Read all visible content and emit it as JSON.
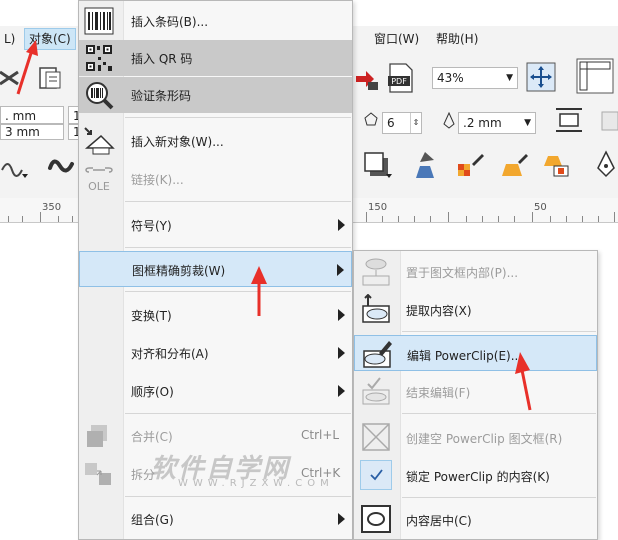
{
  "menubar": {
    "items": [
      {
        "label": "L)"
      },
      {
        "label": "对象(C)",
        "active": true
      },
      {
        "label": "窗口(W)"
      },
      {
        "label": "帮助(H)"
      }
    ]
  },
  "toolbar": {
    "zoom_value": "43%",
    "file_badge": "PDF"
  },
  "propbar": {
    "field1": ". mm",
    "field2": "3 mm",
    "field3": "1",
    "field4": "1",
    "sides_value": "6",
    "outline_value": ".2 mm"
  },
  "ruler": {
    "ticks": [
      "350",
      "150",
      "50"
    ]
  },
  "menu": {
    "items": [
      {
        "label": "插入条码(B)...",
        "icon": "barcode-icon"
      },
      {
        "label": "插入 QR 码",
        "icon": "qr-code-icon"
      },
      {
        "label": "验证条形码",
        "icon": "barcode-magnifier-icon"
      },
      {
        "label": "插入新对象(W)...",
        "icon": "insert-object-icon"
      },
      {
        "label": "链接(K)...",
        "icon": "ole-link-icon"
      },
      {
        "label": "符号(Y)"
      },
      {
        "label": "图框精确剪裁(W)"
      },
      {
        "label": "变换(T)"
      },
      {
        "label": "对齐和分布(A)"
      },
      {
        "label": "顺序(O)"
      },
      {
        "label": "合并(C)",
        "shortcut": "Ctrl+L",
        "icon": "combine-icon"
      },
      {
        "label": "拆分",
        "shortcut": "Ctrl+K",
        "icon": "break-apart-icon"
      },
      {
        "label": "组合(G)"
      }
    ]
  },
  "submenu": {
    "items": [
      {
        "label": "置于图文框内部(P)...",
        "icon": "place-inside-frame-icon"
      },
      {
        "label": "提取内容(X)",
        "icon": "extract-contents-icon"
      },
      {
        "label": "编辑 PowerClip(E)...",
        "icon": "edit-powerclip-icon"
      },
      {
        "label": "结束编辑(F)",
        "icon": "finish-editing-icon"
      },
      {
        "label": "创建空 PowerClip 图文框(R)",
        "icon": "empty-powerclip-frame-icon"
      },
      {
        "label": "锁定 PowerClip 的内容(K)",
        "icon": "checkmark-icon"
      },
      {
        "label": "内容居中(C)",
        "icon": "center-contents-icon"
      }
    ]
  },
  "watermark": {
    "text": "软件自学网",
    "url": "WWW.RJZXW.COM"
  },
  "colors": {
    "highlight_blue": "#d5e8f8",
    "highlight_gray": "#c9c9c9",
    "annotation_red": "#e8302a"
  }
}
